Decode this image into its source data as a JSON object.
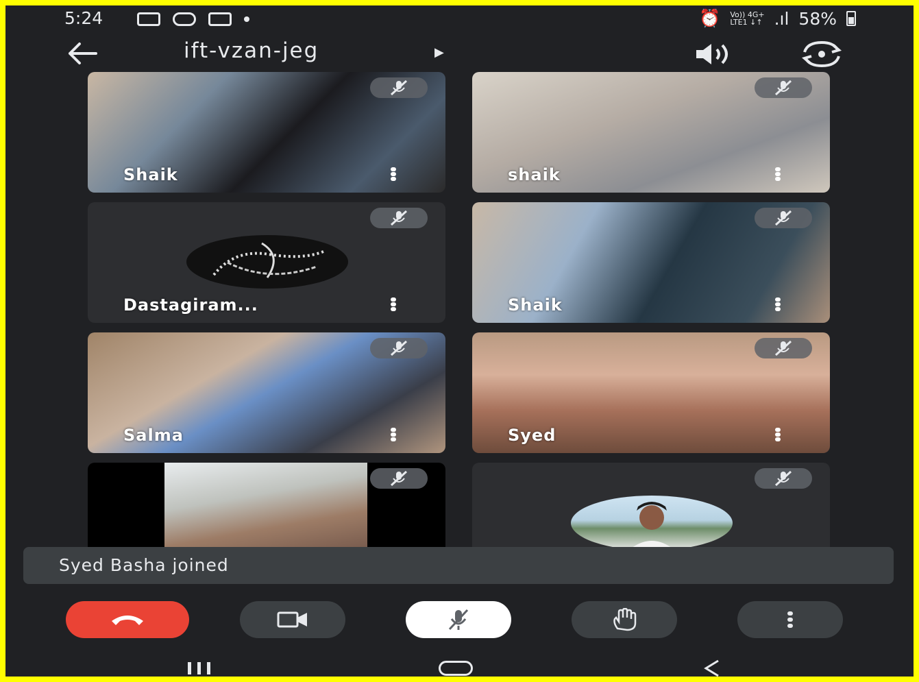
{
  "status_bar": {
    "time": "5:24",
    "network_small": "Vo)) 4G+",
    "network_small2": "LTE1 ↓↑",
    "signal": ".ıl",
    "battery": "58%"
  },
  "meeting": {
    "code": "ift-vzan-jeg"
  },
  "participants": [
    {
      "name": "Shaik"
    },
    {
      "name": "shaik"
    },
    {
      "name": "Dastagiram..."
    },
    {
      "name": "Shaik"
    },
    {
      "name": "Salma"
    },
    {
      "name": "Syed"
    },
    {
      "name": ""
    },
    {
      "name": ""
    }
  ],
  "toast": {
    "message": "Syed Basha joined"
  },
  "colors": {
    "background": "#202124",
    "end_call": "#ea4335",
    "control": "#3c4043",
    "frame": "#ffff00"
  },
  "icons": [
    "back-arrow-icon",
    "speaker-icon",
    "flip-camera-icon",
    "mic-off-icon",
    "more-vert-icon",
    "end-call-icon",
    "video-camera-icon",
    "raise-hand-icon",
    "recent-apps-icon",
    "home-icon",
    "back-nav-icon"
  ]
}
